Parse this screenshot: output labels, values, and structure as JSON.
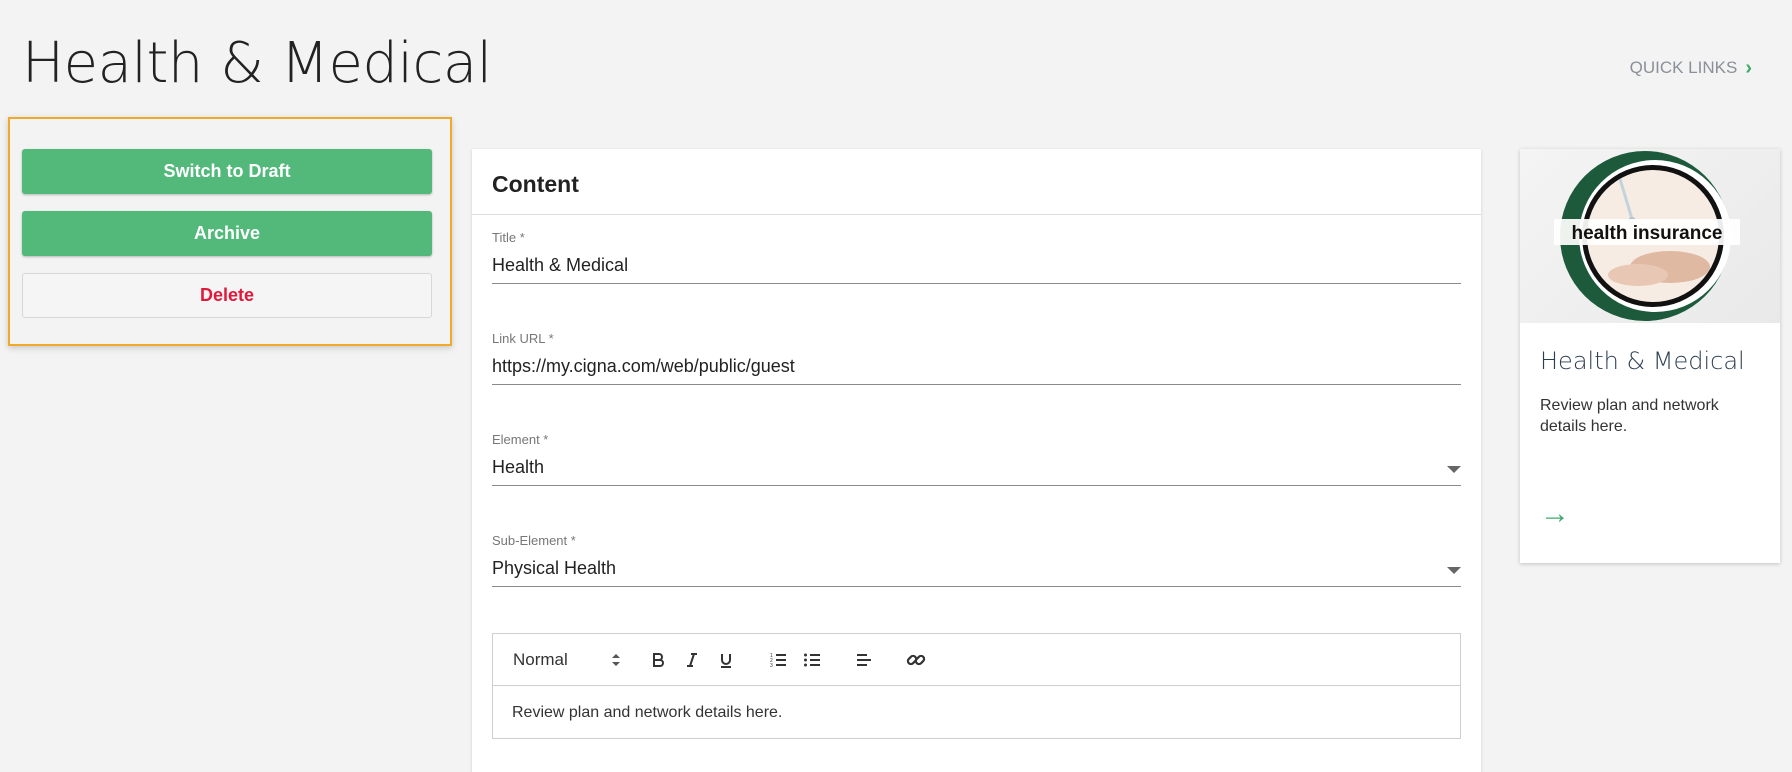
{
  "header": {
    "title": "Health & Medical",
    "quick_links": "QUICK LINKS",
    "quick_links_chevron": "›"
  },
  "actions": {
    "switch_to_draft": "Switch to Draft",
    "archive": "Archive",
    "delete": "Delete"
  },
  "content": {
    "heading": "Content",
    "fields": {
      "title": {
        "label": "Title *",
        "value": "Health & Medical"
      },
      "link_url": {
        "label": "Link URL *",
        "value": "https://my.cigna.com/web/public/guest"
      },
      "element": {
        "label": "Element *",
        "value": "Health"
      },
      "sub_element": {
        "label": "Sub-Element *",
        "value": "Physical Health"
      }
    },
    "editor": {
      "format": "Normal",
      "body": "Review plan and network details here."
    }
  },
  "preview": {
    "image_text": "health insurance",
    "title": "Health & Medical",
    "description": "Review plan and network details here.",
    "arrow": "→"
  },
  "colors": {
    "accent_green": "#52b97b",
    "highlight_orange": "#f0a92b",
    "delete_red": "#e0193c",
    "logo_dark_green": "#1d5a3c"
  }
}
